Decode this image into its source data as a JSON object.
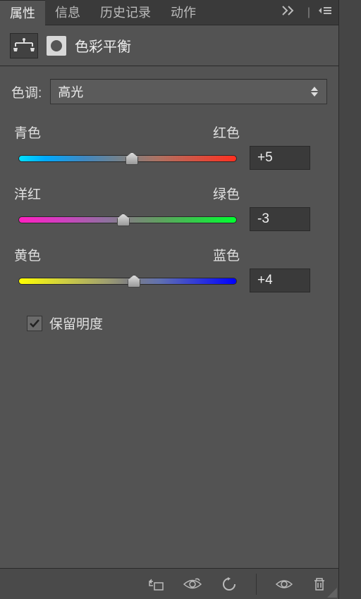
{
  "tabs": {
    "properties": "属性",
    "info": "信息",
    "history": "历史记录",
    "actions": "动作"
  },
  "header": {
    "title": "色彩平衡"
  },
  "tone": {
    "label": "色调:",
    "selected": "高光"
  },
  "sliders": {
    "cyan_red": {
      "left": "青色",
      "right": "红色",
      "value": "+5",
      "pos": 52
    },
    "magenta_green": {
      "left": "洋红",
      "right": "绿色",
      "value": "-3",
      "pos": 48
    },
    "yellow_blue": {
      "left": "黄色",
      "right": "蓝色",
      "value": "+4",
      "pos": 53
    }
  },
  "preserve": {
    "label": "保留明度",
    "checked": true
  }
}
